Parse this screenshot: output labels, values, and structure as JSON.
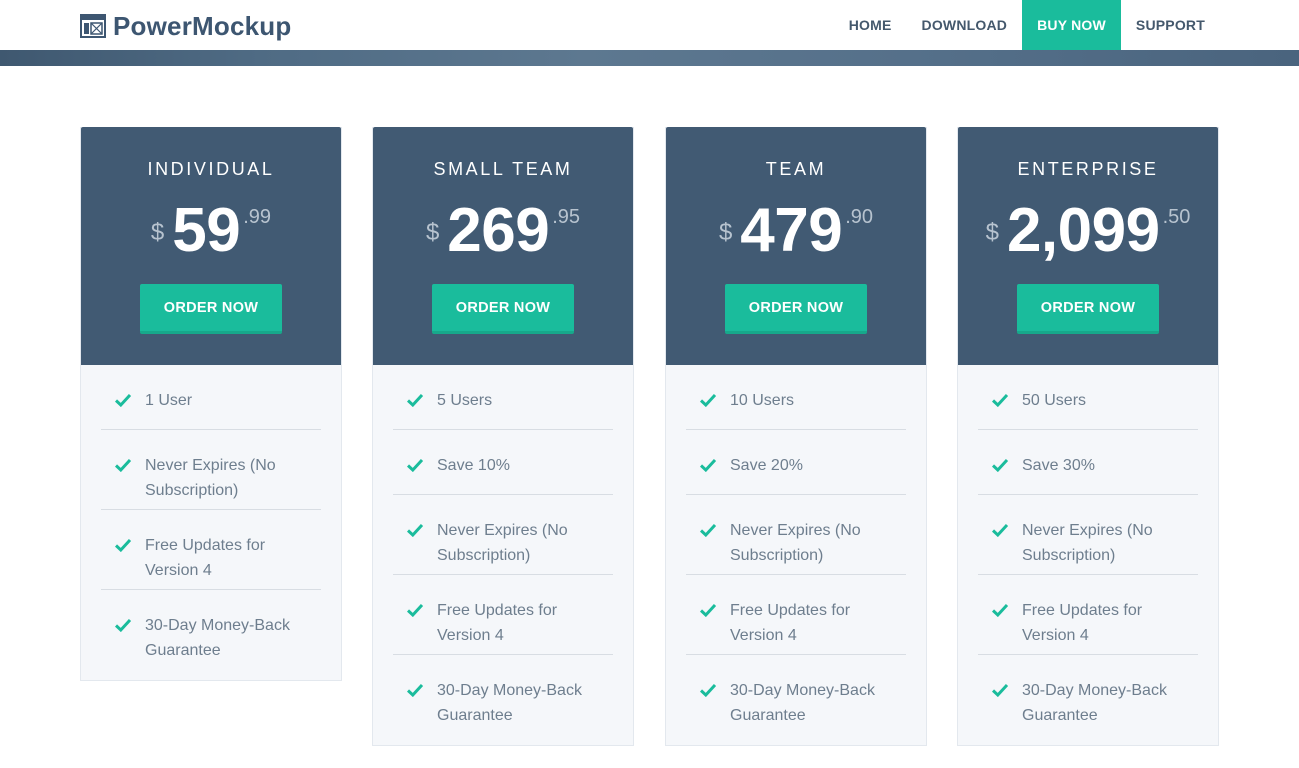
{
  "brand": {
    "name": "PowerMockup",
    "icon": "wireframe-window-icon"
  },
  "nav": {
    "items": [
      {
        "label": "HOME",
        "active": false
      },
      {
        "label": "DOWNLOAD",
        "active": false
      },
      {
        "label": "BUY NOW",
        "active": true
      },
      {
        "label": "SUPPORT",
        "active": false
      }
    ]
  },
  "colors": {
    "accent": "#1abc9c",
    "header": "#415a73",
    "text": "#3d5671",
    "feature_text": "#6e7e8e",
    "card_bg": "#f5f7fa"
  },
  "plans": [
    {
      "name": "INDIVIDUAL",
      "currency": "$",
      "amount": "59",
      "cents": ".99",
      "button": "ORDER NOW",
      "features": [
        "1 User",
        "Never Expires (No Subscription)",
        "Free Updates for Version 4",
        "30-Day Money-Back Guarantee"
      ]
    },
    {
      "name": "SMALL TEAM",
      "currency": "$",
      "amount": "269",
      "cents": ".95",
      "button": "ORDER NOW",
      "features": [
        "5 Users",
        "Save 10%",
        "Never Expires (No Subscription)",
        "Free Updates for Version 4",
        "30-Day Money-Back Guarantee"
      ]
    },
    {
      "name": "TEAM",
      "currency": "$",
      "amount": "479",
      "cents": ".90",
      "button": "ORDER NOW",
      "features": [
        "10 Users",
        "Save 20%",
        "Never Expires (No Subscription)",
        "Free Updates for Version 4",
        "30-Day Money-Back Guarantee"
      ]
    },
    {
      "name": "ENTERPRISE",
      "currency": "$",
      "amount": "2,099",
      "cents": ".50",
      "button": "ORDER NOW",
      "features": [
        "50 Users",
        "Save 30%",
        "Never Expires (No Subscription)",
        "Free Updates for Version 4",
        "30-Day Money-Back Guarantee"
      ]
    }
  ]
}
